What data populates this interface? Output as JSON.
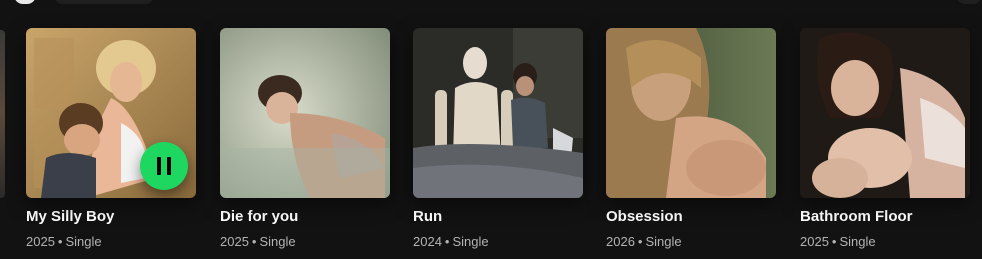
{
  "releases": [
    {
      "title": "My Silly Boy",
      "year": "2025",
      "type": "Single",
      "playing": true
    },
    {
      "title": "Die for you",
      "year": "2025",
      "type": "Single",
      "playing": false
    },
    {
      "title": "Run",
      "year": "2024",
      "type": "Single",
      "playing": false
    },
    {
      "title": "Obsession",
      "year": "2026",
      "type": "Single",
      "playing": false
    },
    {
      "title": "Bathroom Floor",
      "year": "2025",
      "type": "Single",
      "playing": false
    }
  ],
  "separator": "•",
  "icons": {
    "play_state": "pause-icon"
  },
  "colors": {
    "background": "#121212",
    "accent": "#1ed760",
    "subtext": "#b3b3b3"
  }
}
